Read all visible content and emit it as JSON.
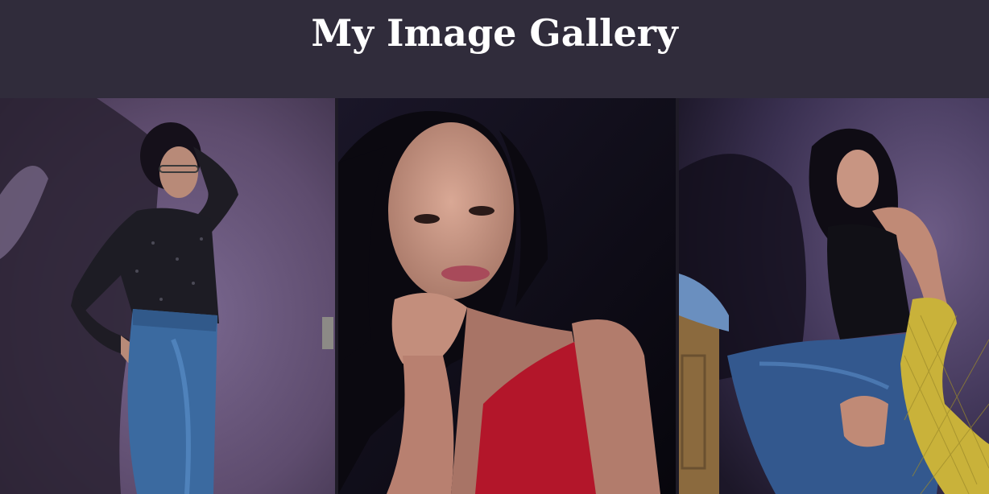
{
  "header": {
    "title": "My Image Gallery"
  },
  "gallery": {
    "images": [
      {
        "alt": "",
        "subject": "woman-posing-black-sparkly-top-jeans-purple-wall"
      },
      {
        "alt": "",
        "subject": "woman-portrait-red-top-hand-under-chin-dark"
      },
      {
        "alt": "",
        "subject": "woman-black-top-jeans-yellow-net-shawl-seated"
      }
    ]
  },
  "colors": {
    "header_bg": "#302c3b",
    "title_text": "#ffffff",
    "wall_purple": "#5b4a6a",
    "dark_bg": "#0d0b14",
    "jeans_blue": "#3c6ea8",
    "red_top": "#b3162a",
    "shawl_yellow": "#c9b23a"
  }
}
